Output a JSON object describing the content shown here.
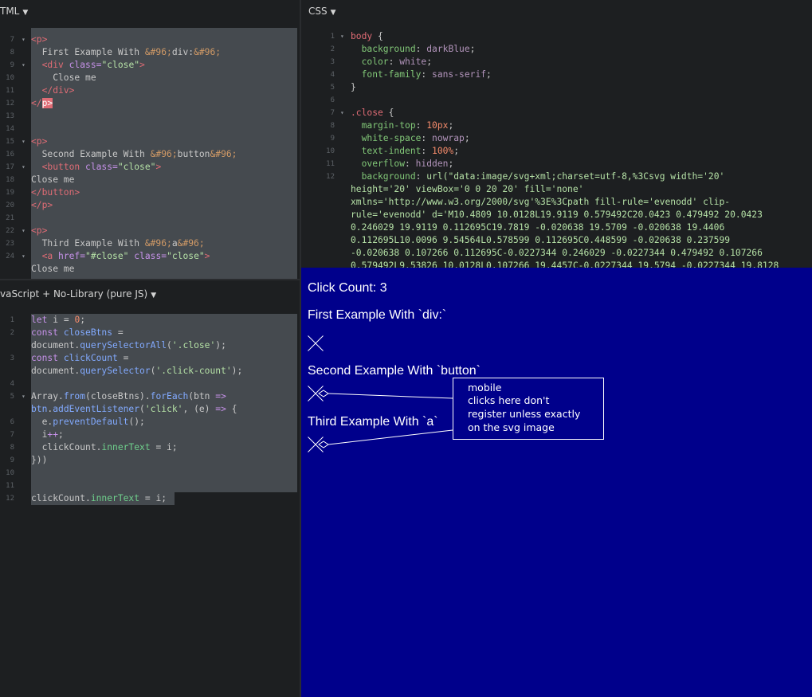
{
  "html_panel": {
    "header": "TML",
    "lines": [
      {
        "n": "7",
        "fold": true,
        "parts": [
          [
            "c-tag",
            "<p>"
          ]
        ]
      },
      {
        "n": "8",
        "parts": [
          [
            "c-text",
            "  First Example With "
          ],
          [
            "c-ent",
            "&#96;"
          ],
          [
            "c-text",
            "div:"
          ],
          [
            "c-ent",
            "&#96;"
          ]
        ]
      },
      {
        "n": "9",
        "fold": true,
        "parts": [
          [
            "c-text",
            "  "
          ],
          [
            "c-tag",
            "<div "
          ],
          [
            "c-attr",
            "class="
          ],
          [
            "c-str",
            "\"close\""
          ],
          [
            "c-tag",
            ">"
          ]
        ]
      },
      {
        "n": "10",
        "parts": [
          [
            "c-text",
            "    Close me"
          ]
        ]
      },
      {
        "n": "11",
        "parts": [
          [
            "c-text",
            "  "
          ],
          [
            "c-tag",
            "</div>"
          ]
        ]
      },
      {
        "n": "12",
        "parts": [
          [
            "c-tag",
            "</"
          ],
          [
            "tag-hl",
            "p>"
          ]
        ]
      },
      {
        "n": "13",
        "parts": []
      },
      {
        "n": "14",
        "parts": []
      },
      {
        "n": "15",
        "fold": true,
        "parts": [
          [
            "c-tag",
            "<p>"
          ]
        ]
      },
      {
        "n": "16",
        "parts": [
          [
            "c-text",
            "  Second Example With "
          ],
          [
            "c-ent",
            "&#96;"
          ],
          [
            "c-text",
            "button"
          ],
          [
            "c-ent",
            "&#96;"
          ]
        ]
      },
      {
        "n": "17",
        "fold": true,
        "parts": [
          [
            "c-text",
            "  "
          ],
          [
            "c-tag",
            "<button "
          ],
          [
            "c-attr",
            "class="
          ],
          [
            "c-str",
            "\"close\""
          ],
          [
            "c-tag",
            ">"
          ]
        ]
      },
      {
        "n": "18",
        "parts": [
          [
            "c-text",
            "Close me"
          ]
        ]
      },
      {
        "n": "19",
        "parts": [
          [
            "c-tag",
            "</button>"
          ]
        ]
      },
      {
        "n": "20",
        "parts": [
          [
            "c-tag",
            "</p>"
          ]
        ]
      },
      {
        "n": "21",
        "parts": []
      },
      {
        "n": "22",
        "fold": true,
        "parts": [
          [
            "c-tag",
            "<p>"
          ]
        ]
      },
      {
        "n": "23",
        "parts": [
          [
            "c-text",
            "  Third Example With "
          ],
          [
            "c-ent",
            "&#96;"
          ],
          [
            "c-text",
            "a"
          ],
          [
            "c-ent",
            "&#96;"
          ]
        ]
      },
      {
        "n": "24",
        "fold": true,
        "parts": [
          [
            "c-text",
            "  "
          ],
          [
            "c-tag",
            "<a "
          ],
          [
            "c-attr",
            "href="
          ],
          [
            "c-str",
            "\"#close\" "
          ],
          [
            "c-attr",
            "class="
          ],
          [
            "c-str",
            "\"close\""
          ],
          [
            "c-tag",
            ">"
          ]
        ]
      },
      {
        "n": "",
        "parts": [
          [
            "c-text",
            "Close me"
          ]
        ]
      }
    ]
  },
  "css_panel": {
    "header": "CSS",
    "lines": [
      {
        "n": "1",
        "fold": true,
        "parts": [
          [
            "c-sel",
            "body"
          ],
          [
            "c-punc",
            " {"
          ]
        ]
      },
      {
        "n": "2",
        "parts": [
          [
            "c-cssprop",
            "  background"
          ],
          [
            "c-punc",
            ": "
          ],
          [
            "c-cssval",
            "darkBlue"
          ],
          [
            "c-punc",
            ";"
          ]
        ]
      },
      {
        "n": "3",
        "parts": [
          [
            "c-cssprop",
            "  color"
          ],
          [
            "c-punc",
            ": "
          ],
          [
            "c-cssval",
            "white"
          ],
          [
            "c-punc",
            ";"
          ]
        ]
      },
      {
        "n": "4",
        "parts": [
          [
            "c-cssprop",
            "  font-family"
          ],
          [
            "c-punc",
            ": "
          ],
          [
            "c-cssval",
            "sans-serif"
          ],
          [
            "c-punc",
            ";"
          ]
        ]
      },
      {
        "n": "5",
        "parts": [
          [
            "c-punc",
            "}"
          ]
        ]
      },
      {
        "n": "6",
        "parts": []
      },
      {
        "n": "7",
        "fold": true,
        "parts": [
          [
            "c-sel",
            ".close"
          ],
          [
            "c-punc",
            " {"
          ]
        ]
      },
      {
        "n": "8",
        "parts": [
          [
            "c-cssprop",
            "  margin-top"
          ],
          [
            "c-punc",
            ": "
          ],
          [
            "c-num",
            "10px"
          ],
          [
            "c-punc",
            ";"
          ]
        ]
      },
      {
        "n": "9",
        "parts": [
          [
            "c-cssprop",
            "  white-space"
          ],
          [
            "c-punc",
            ": "
          ],
          [
            "c-cssval",
            "nowrap"
          ],
          [
            "c-punc",
            ";"
          ]
        ]
      },
      {
        "n": "10",
        "parts": [
          [
            "c-cssprop",
            "  text-indent"
          ],
          [
            "c-punc",
            ": "
          ],
          [
            "c-num",
            "100%"
          ],
          [
            "c-punc",
            ";"
          ]
        ]
      },
      {
        "n": "11",
        "parts": [
          [
            "c-cssprop",
            "  overflow"
          ],
          [
            "c-punc",
            ": "
          ],
          [
            "c-cssval",
            "hidden"
          ],
          [
            "c-punc",
            ";"
          ]
        ]
      },
      {
        "n": "12",
        "parts": [
          [
            "c-cssprop",
            "  background"
          ],
          [
            "c-punc",
            ": "
          ],
          [
            "c-str",
            "url(\"data:image/svg+xml;charset=utf-8,%3Csvg width='20'"
          ]
        ]
      },
      {
        "n": "",
        "parts": [
          [
            "c-str",
            "height='20' viewBox='0 0 20 20' fill='none'"
          ]
        ]
      },
      {
        "n": "",
        "parts": [
          [
            "c-str",
            "xmlns='http://www.w3.org/2000/svg'%3E%3Cpath fill-rule='evenodd' clip-"
          ]
        ]
      },
      {
        "n": "",
        "parts": [
          [
            "c-str",
            "rule='evenodd' d='M10.4809 10.0128L19.9119 0.579492C20.0423 0.479492 20.0423"
          ]
        ]
      },
      {
        "n": "",
        "parts": [
          [
            "c-str",
            "0.246029 19.9119 0.112695C19.7819 -0.020638 19.5709 -0.020638 19.4406"
          ]
        ]
      },
      {
        "n": "",
        "parts": [
          [
            "c-str",
            "0.112695L10.0096 9.54564L0.578599 0.112695C0.448599 -0.020638 0.237599"
          ]
        ]
      },
      {
        "n": "",
        "parts": [
          [
            "c-str",
            "-0.020638 0.107266 0.112695C-0.0227344 0.246029 -0.0227344 0.479492 0.107266"
          ]
        ]
      },
      {
        "n": "",
        "parts": [
          [
            "c-str",
            "0.579492L9.53826 10.0128L0.107266 19.4457C-0.0227344 19.5794 -0.0227344 19.8128"
          ]
        ]
      }
    ]
  },
  "js_panel": {
    "header": "vaScript + No-Library (pure JS)",
    "lines": [
      {
        "n": "1",
        "parts": [
          [
            "c-kw",
            "let "
          ],
          [
            "c-text",
            "i = "
          ],
          [
            "c-num",
            "0"
          ],
          [
            "c-text",
            ";"
          ]
        ]
      },
      {
        "n": "2",
        "parts": [
          [
            "c-kw",
            "const "
          ],
          [
            "c-fn",
            "closeBtns"
          ],
          [
            "c-text",
            " ="
          ]
        ]
      },
      {
        "n": "",
        "parts": [
          [
            "c-text",
            "document."
          ],
          [
            "c-fn",
            "querySelectorAll"
          ],
          [
            "c-text",
            "("
          ],
          [
            "c-str",
            "'.close'"
          ],
          [
            "c-text",
            ");"
          ]
        ]
      },
      {
        "n": "3",
        "parts": [
          [
            "c-kw",
            "const "
          ],
          [
            "c-fn",
            "clickCount"
          ],
          [
            "c-text",
            " ="
          ]
        ]
      },
      {
        "n": "",
        "parts": [
          [
            "c-text",
            "document."
          ],
          [
            "c-fn",
            "querySelector"
          ],
          [
            "c-text",
            "("
          ],
          [
            "c-str",
            "'.click-count'"
          ],
          [
            "c-text",
            ");"
          ]
        ]
      },
      {
        "n": "4",
        "parts": []
      },
      {
        "n": "5",
        "fold": true,
        "parts": [
          [
            "c-text",
            "Array."
          ],
          [
            "c-fn",
            "from"
          ],
          [
            "c-text",
            "(closeBtns)."
          ],
          [
            "c-fn",
            "forEach"
          ],
          [
            "c-text",
            "(btn "
          ],
          [
            "c-kw",
            "=>"
          ]
        ]
      },
      {
        "n": "",
        "parts": [
          [
            "c-fn",
            "btn"
          ],
          [
            "c-text",
            "."
          ],
          [
            "c-fn",
            "addEventListener"
          ],
          [
            "c-text",
            "("
          ],
          [
            "c-str",
            "'click'"
          ],
          [
            "c-text",
            ", (e) "
          ],
          [
            "c-kw",
            "=>"
          ],
          [
            "c-text",
            " {"
          ]
        ]
      },
      {
        "n": "6",
        "parts": [
          [
            "c-text",
            "  e."
          ],
          [
            "c-fn",
            "preventDefault"
          ],
          [
            "c-text",
            "();"
          ]
        ]
      },
      {
        "n": "7",
        "parts": [
          [
            "c-text",
            "  i"
          ],
          [
            "c-kw",
            "++"
          ],
          [
            "c-text",
            ";"
          ]
        ]
      },
      {
        "n": "8",
        "parts": [
          [
            "c-text",
            "  clickCount."
          ],
          [
            "c-prop",
            "innerText"
          ],
          [
            "c-text",
            " = i;"
          ]
        ]
      },
      {
        "n": "9",
        "parts": [
          [
            "c-text",
            "}))"
          ]
        ]
      },
      {
        "n": "10",
        "parts": []
      },
      {
        "n": "11",
        "parts": []
      },
      {
        "n": "12",
        "parts": [
          [
            "c-text",
            "clickCount."
          ],
          [
            "c-prop",
            "innerText"
          ],
          [
            "c-text",
            " = i;"
          ]
        ]
      }
    ]
  },
  "preview": {
    "click_count": "Click Count: 3",
    "example1": "First Example With `div:`",
    "example2": "Second Example With `button`",
    "example3": "Third Example With `a`",
    "callout": {
      "line1": "mobile",
      "line2": "clicks here don't",
      "line3": "register unless exactly",
      "line4": "on the svg image"
    }
  },
  "colors": {
    "editor_bg": "#1d1f21",
    "selection": "#454a4f",
    "preview_bg": "#00008b"
  }
}
